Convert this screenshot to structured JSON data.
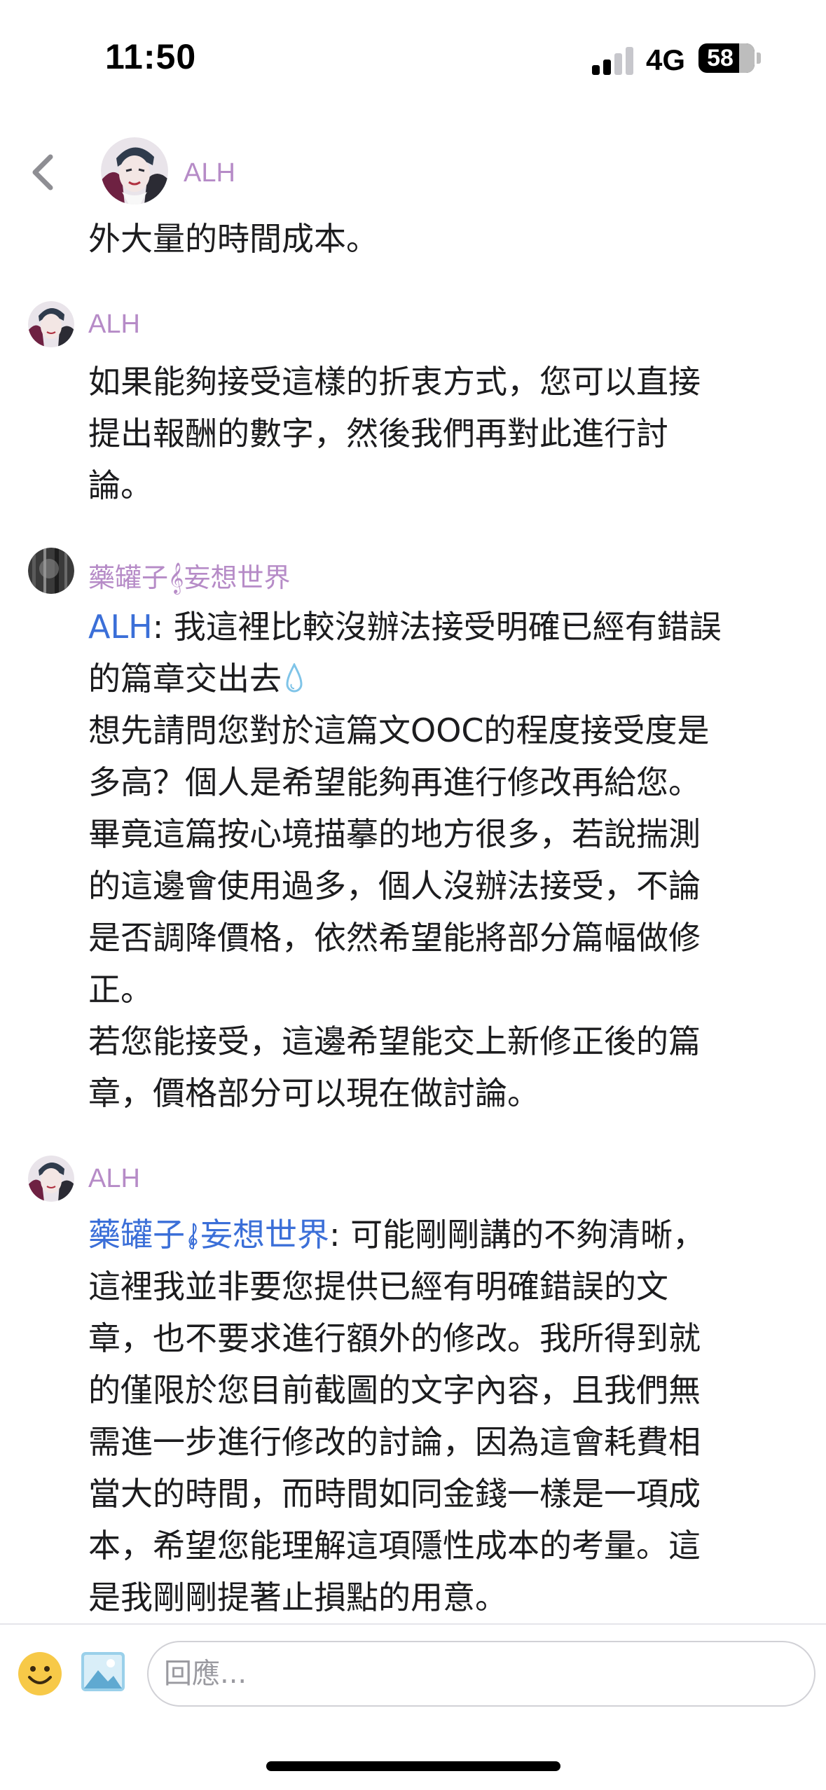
{
  "status_bar": {
    "time": "11:50",
    "network": "4G",
    "battery_percent": "58",
    "signal_bars_active": 2,
    "signal_bars_total": 4
  },
  "header": {
    "title": "ALH",
    "back_icon": "chevron-left-icon"
  },
  "messages": [
    {
      "lines": [
        "外大量的時間成本。"
      ]
    },
    {
      "sender": "ALH",
      "lines": [
        "如果能夠接受這樣的折衷方式，您可以直接",
        "提出報酬的數字，然後我們再對此進行討",
        "論。"
      ]
    },
    {
      "sender": "藥罐子𝄞妄想世界",
      "mention": "ALH",
      "mention_rest": ": 我這裡比較沒辦法接受明確已經有錯誤",
      "line2": "的篇章交出去",
      "lines": [
        "想先請問您對於這篇文OOC的程度接受度是",
        "多高？個人是希望能夠再進行修改再給您。",
        "畢竟這篇按心境描摹的地方很多，若說揣測",
        "的這邊會使用過多，個人沒辦法接受，不論",
        "是否調降價格，依然希望能將部分篇幅做修",
        "正。",
        "若您能接受，這邊希望能交上新修正後的篇",
        "章，價格部分可以現在做討論。"
      ]
    },
    {
      "sender": "ALH",
      "mention_a": "藥罐子",
      "mention_b": "妄想世界",
      "mention_rest": ": 可能剛剛講的不夠清晰，",
      "lines": [
        "這裡我並非要您提供已經有明確錯誤的文",
        "章，也不要求進行額外的修改。我所得到就",
        "的僅限於您目前截圖的文字內容，且我們無",
        "需進一步進行修改的討論，因為這會耗費相",
        "當大的時間，而時間如同金錢一樣是一項成",
        "本，希望您能理解這項隱性成本的考量。這",
        "是我剛剛提著止損點的用意。"
      ]
    }
  ],
  "composer": {
    "placeholder": "回應...",
    "emoji_icon": "smiley-icon",
    "image_icon": "image-icon"
  },
  "colors": {
    "sender_name": "#b68bc7",
    "mention": "#3b6fd8",
    "text": "#1c1c1e"
  }
}
